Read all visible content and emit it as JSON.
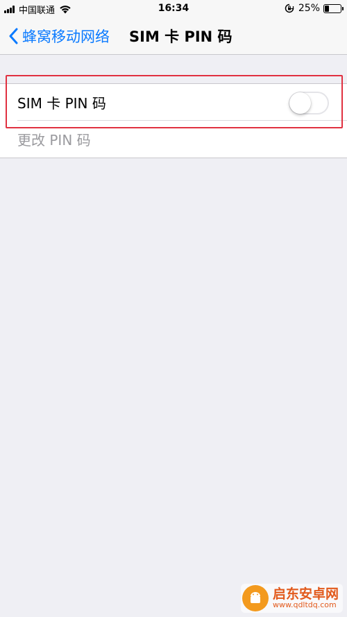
{
  "status_bar": {
    "carrier": "中国联通",
    "time": "16:34",
    "battery_percent_label": "25%",
    "battery_level": 0.25
  },
  "nav": {
    "back_label": "蜂窝移动网络",
    "title": "SIM 卡 PIN 码"
  },
  "settings": {
    "sim_pin_label": "SIM 卡 PIN 码",
    "sim_pin_enabled": false,
    "change_pin_label": "更改 PIN 码"
  },
  "watermark": {
    "title": "启东安卓网",
    "url": "www.qdltdq.com"
  },
  "colors": {
    "accent": "#0a7aff",
    "background": "#efeff4",
    "highlight": "#e03040"
  }
}
